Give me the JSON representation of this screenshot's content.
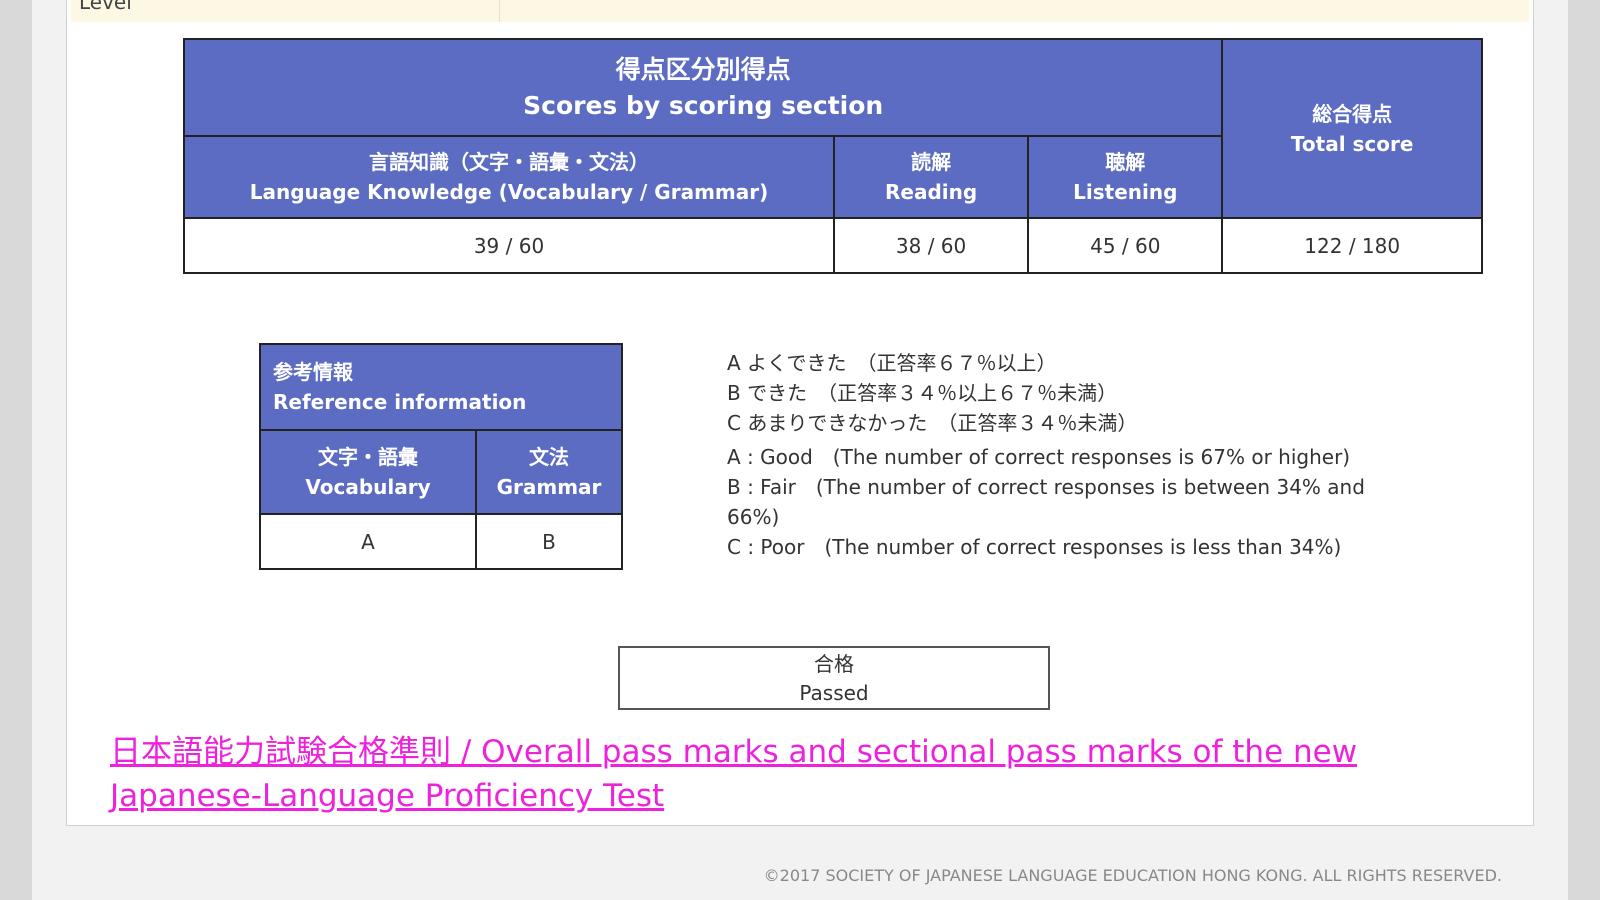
{
  "level": {
    "label": "Level"
  },
  "scores_table": {
    "title_jp": "得点区分別得点",
    "title_en": "Scores by scoring section",
    "total_jp": "総合得点",
    "total_en": "Total score",
    "columns": [
      {
        "jp": "言語知識（文字・語彙・文法）",
        "en": "Language Knowledge (Vocabulary / Grammar)",
        "value": "39 / 60"
      },
      {
        "jp": "読解",
        "en": "Reading",
        "value": "38 / 60"
      },
      {
        "jp": "聴解",
        "en": "Listening",
        "value": "45 / 60"
      }
    ],
    "total_value": "122 / 180"
  },
  "reference_table": {
    "title_jp": "参考情報",
    "title_en": "Reference information",
    "columns": [
      {
        "jp": "文字・語彙",
        "en": "Vocabulary",
        "value": "A"
      },
      {
        "jp": "文法",
        "en": "Grammar",
        "value": "B"
      }
    ]
  },
  "legend": {
    "jp": [
      "A よくできた　（正答率６７％以上）",
      "B できた　（正答率３４％以上６７％未満）",
      "C あまりできなかった　（正答率３４％未満）"
    ],
    "en": [
      "A : Good　(The number of correct responses is 67% or higher)",
      "B : Fair　(The number of correct responses is between 34% and 66%)",
      "C : Poor　(The number of correct responses is less than 34%)"
    ]
  },
  "result": {
    "jp": "合格",
    "en": "Passed"
  },
  "pass_marks_link": {
    "text": "日本語能力試験合格準則 / Overall pass marks and sectional pass marks of the new Japanese-Language Proficiency Test"
  },
  "footer": {
    "copyright": "©2017 SOCIETY OF JAPANESE LANGUAGE EDUCATION HONG KONG. ALL RIGHTS RESERVED."
  },
  "colors": {
    "header_blue": "#5b6cc2",
    "link_magenta": "#ee22dd",
    "level_row_bg": "#fcf8e3"
  }
}
